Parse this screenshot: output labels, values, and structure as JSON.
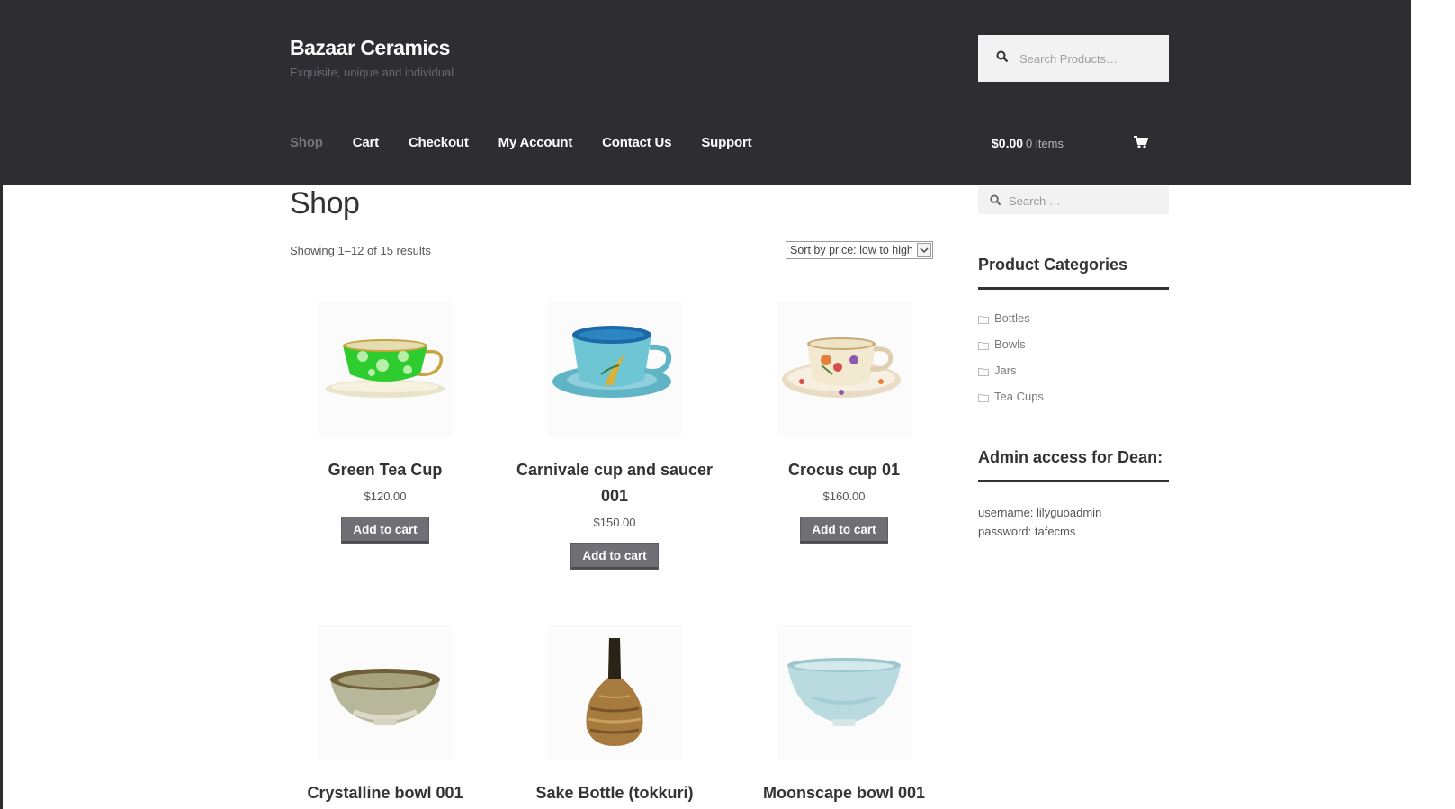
{
  "site": {
    "title": "Bazaar Ceramics",
    "tagline": "Exquisite, unique and individual"
  },
  "header_search": {
    "placeholder": "Search Products…"
  },
  "nav": {
    "items": [
      {
        "label": "Shop",
        "active": true
      },
      {
        "label": "Cart"
      },
      {
        "label": "Checkout"
      },
      {
        "label": "My Account"
      },
      {
        "label": "Contact Us"
      },
      {
        "label": "Support"
      }
    ]
  },
  "mini_cart": {
    "amount": "$0.00",
    "items": "0 items",
    "icon": "cart-icon"
  },
  "page": {
    "title": "Shop",
    "result_count": "Showing 1–12 of 15 results"
  },
  "sorting": {
    "selected": "Sort by price: low to high"
  },
  "products": [
    {
      "name": "Green Tea Cup",
      "price": "$120.00",
      "button": "Add to cart"
    },
    {
      "name": "Carnivale cup and saucer 001",
      "price": "$150.00",
      "button": "Add to cart"
    },
    {
      "name": "Crocus cup 01",
      "price": "$160.00",
      "button": "Add to cart"
    },
    {
      "name": "Crystalline bowl 001"
    },
    {
      "name": "Sake Bottle (tokkuri)"
    },
    {
      "name": "Moonscape bowl 001"
    }
  ],
  "sidebar": {
    "search_placeholder": "Search …",
    "categories_title": "Product Categories",
    "categories": [
      "Bottles",
      "Bowls",
      "Jars",
      "Tea Cups"
    ],
    "admin_title": "Admin access for Dean:",
    "admin_username": "username: lilyguoadmin",
    "admin_password": "password: tafecms"
  },
  "colors": {
    "header_bg": "#2d2d32",
    "button_bg": "#6f6f75",
    "active_nav": "#737378"
  }
}
